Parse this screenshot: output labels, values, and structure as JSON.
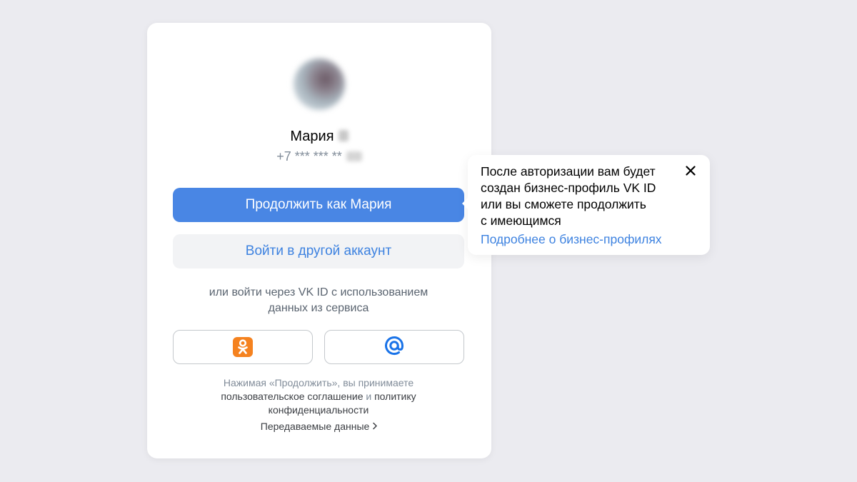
{
  "auth": {
    "user_name": "Мария",
    "phone": "+7 *** *** **",
    "continue_button": "Продолжить как Мария",
    "other_account_button": "Войти в другой аккаунт",
    "alt_line1": "или войти через VK ID с использованием",
    "alt_line2": "данных из сервиса",
    "services": [
      {
        "name": "odnoklassniki",
        "icon": "ok-icon",
        "color": "#f5821f"
      },
      {
        "name": "mail",
        "icon": "at-icon",
        "color": "#1a73e8"
      }
    ],
    "terms_prefix": "Нажимая «Продолжить», вы принимаете",
    "terms_agreement": "пользовательское соглашение",
    "terms_and": " и ",
    "terms_policy": "политику",
    "terms_policy2": "конфиденциальности",
    "data_link": "Передаваемые данные"
  },
  "tooltip": {
    "line1": "После авторизации вам будет",
    "line2": "создан бизнес-профиль VK ID",
    "line3": "или вы сможете продолжить",
    "line4": "с имеющимся",
    "link": "Подробнее о бизнес-профилях"
  },
  "colors": {
    "accent": "#4986e4",
    "link": "#3d82e0",
    "background": "#ebebf0"
  }
}
